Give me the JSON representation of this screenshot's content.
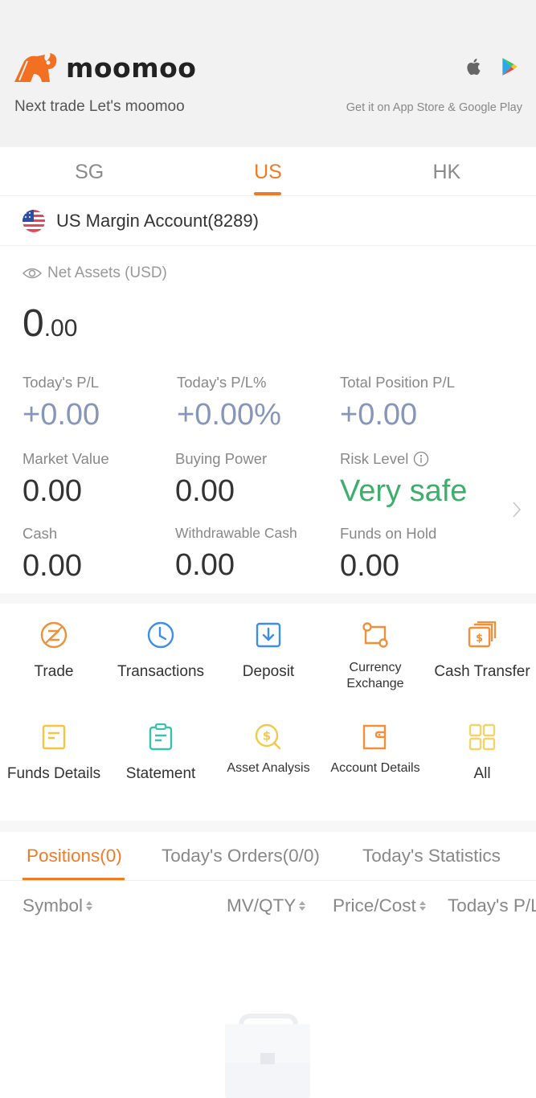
{
  "banner": {
    "brand": "moomoo",
    "tagline": "Next trade Let's moomoo",
    "store_caption": "Get it on App Store & Google Play",
    "icons": [
      "apple-icon",
      "google-play-icon"
    ]
  },
  "market_tabs": [
    {
      "label": "SG",
      "active": false
    },
    {
      "label": "US",
      "active": true
    },
    {
      "label": "HK",
      "active": false
    }
  ],
  "account": {
    "flag": "us-flag-icon",
    "name": "US Margin Account(8289)"
  },
  "net_assets": {
    "label": "Net Assets (USD)",
    "value_int": "0",
    "value_dec": ".00"
  },
  "metrics": {
    "todays_pl": {
      "label": "Today's P/L",
      "value": "+0.00"
    },
    "todays_pl_pct": {
      "label": "Today's P/L%",
      "value": "+0.00%"
    },
    "total_position_pl": {
      "label": "Total Position P/L",
      "value": "+0.00"
    },
    "market_value": {
      "label": "Market Value",
      "value": "0.00"
    },
    "buying_power": {
      "label": "Buying Power",
      "value": "0.00"
    },
    "risk_level": {
      "label": "Risk Level",
      "value": "Very safe"
    },
    "cash": {
      "label": "Cash",
      "value": "0.00"
    },
    "withdrawable_cash": {
      "label": "Withdrawable Cash",
      "value": "0.00"
    },
    "funds_on_hold": {
      "label": "Funds on Hold",
      "value": "0.00"
    }
  },
  "actions": [
    {
      "label": "Trade",
      "icon": "trade-icon"
    },
    {
      "label": "Transactions",
      "icon": "clock-icon"
    },
    {
      "label": "Deposit",
      "icon": "deposit-icon"
    },
    {
      "label": "Currency Exchange",
      "icon": "currency-exchange-icon"
    },
    {
      "label": "Cash Transfer",
      "icon": "cash-transfer-icon"
    },
    {
      "label": "Funds Details",
      "icon": "funds-details-icon"
    },
    {
      "label": "Statement",
      "icon": "statement-icon"
    },
    {
      "label": "Asset Analysis",
      "icon": "asset-analysis-icon"
    },
    {
      "label": "Account Details",
      "icon": "wallet-icon"
    },
    {
      "label": "All",
      "icon": "grid-icon"
    }
  ],
  "position_tabs": [
    {
      "label": "Positions(0)",
      "active": true
    },
    {
      "label": "Today's Orders(0/0)",
      "active": false
    },
    {
      "label": "Today's Statistics",
      "active": false
    }
  ],
  "columns": [
    "Symbol",
    "MV/QTY",
    "Price/Cost",
    "Today's P/L"
  ],
  "colors": {
    "accent": "#f07a26",
    "pl_neutral": "#8696b8",
    "safe": "#3fae6c"
  }
}
